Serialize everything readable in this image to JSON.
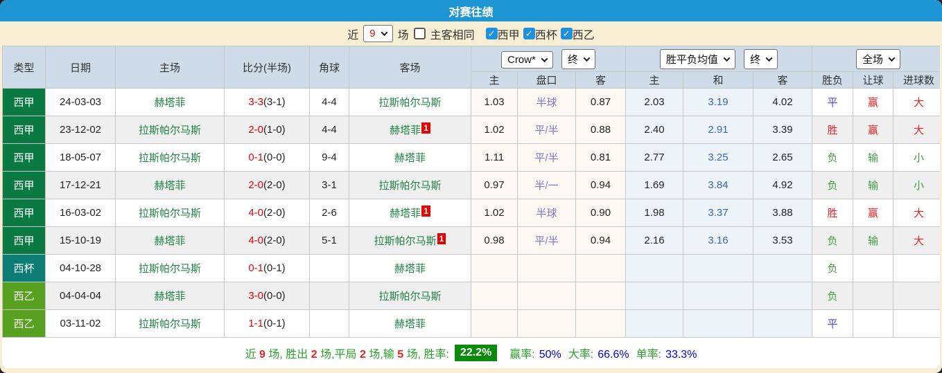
{
  "title": "对赛往绩",
  "colors": {
    "title_bar": "#1f96d4",
    "frame": "#f7eed3",
    "header_bg": "#cedbe9",
    "row_alt": "#efefef",
    "odds_col_bg": "#fdf9f2",
    "avg_col_bg": "#ecf4fa",
    "liga_badge": "#0a7a42",
    "cup_badge": "#0c7d74",
    "segunda_badge": "#57a020",
    "team_green": "#1f8442",
    "score_red": "#e60000",
    "handicap_purple": "#7b76cc",
    "avg_blue": "#3a67ad",
    "result_red": "#e62628",
    "result_green": "#459a45",
    "result_blue": "#4b43e8",
    "checkbox_blue": "#1e90dd",
    "rate_badge_bg": "#0a8a0a",
    "stat_value_blue": "#0000dd",
    "label_green": "#2ba12b"
  },
  "filter": {
    "near_label": "近",
    "count_value": "9",
    "matches_label": "场",
    "check_glyph": "✓",
    "same_venue": {
      "label": "主客相同",
      "checked": false
    },
    "leagues": [
      {
        "label": "西甲",
        "checked": true
      },
      {
        "label": "西杯",
        "checked": true
      },
      {
        "label": "西乙",
        "checked": true
      }
    ]
  },
  "table": {
    "left_headers": [
      "类型",
      "日期",
      "主场",
      "比分(半场)",
      "角球",
      "客场"
    ],
    "groups": [
      {
        "select1": "Crow*",
        "select2": "终",
        "cols": [
          "主",
          "盘口",
          "客"
        ]
      },
      {
        "select1": "胜平负均值",
        "select2": "终",
        "cols": [
          "主",
          "和",
          "客"
        ]
      },
      {
        "select1": "全场",
        "cols": [
          "胜负",
          "让球",
          "进球数"
        ]
      }
    ],
    "rows": [
      {
        "league": "西甲",
        "league_color": "#0a7a42",
        "date": "24-03-03",
        "home": "赫塔菲",
        "score": "3-3",
        "half": "(3-1)",
        "corner": "4-4",
        "away": "拉斯帕尔马斯",
        "away_badge": "",
        "odds": [
          "1.03",
          "半球",
          "0.87"
        ],
        "avg": [
          "2.03",
          "3.19",
          "4.02"
        ],
        "results": [
          {
            "t": "平",
            "c": "blue"
          },
          {
            "t": "赢",
            "c": "red"
          },
          {
            "t": "大",
            "c": "red"
          }
        ]
      },
      {
        "league": "西甲",
        "league_color": "#0a7a42",
        "date": "23-12-02",
        "home": "拉斯帕尔马斯",
        "score": "2-0",
        "half": "(1-0)",
        "corner": "4-4",
        "away": "赫塔菲",
        "away_badge": "1",
        "odds": [
          "1.02",
          "平/半",
          "0.88"
        ],
        "avg": [
          "2.40",
          "2.91",
          "3.39"
        ],
        "results": [
          {
            "t": "胜",
            "c": "red"
          },
          {
            "t": "赢",
            "c": "red"
          },
          {
            "t": "大",
            "c": "red"
          }
        ]
      },
      {
        "league": "西甲",
        "league_color": "#0a7a42",
        "date": "18-05-07",
        "home": "拉斯帕尔马斯",
        "score": "0-1",
        "half": "(0-0)",
        "corner": "9-4",
        "away": "赫塔菲",
        "away_badge": "",
        "odds": [
          "1.11",
          "平/半",
          "0.81"
        ],
        "avg": [
          "2.77",
          "3.25",
          "2.65"
        ],
        "results": [
          {
            "t": "负",
            "c": "green"
          },
          {
            "t": "输",
            "c": "green"
          },
          {
            "t": "小",
            "c": "green"
          }
        ]
      },
      {
        "league": "西甲",
        "league_color": "#0a7a42",
        "date": "17-12-21",
        "home": "赫塔菲",
        "score": "2-0",
        "half": "(2-0)",
        "corner": "3-1",
        "away": "拉斯帕尔马斯",
        "away_badge": "",
        "odds": [
          "0.97",
          "半/一",
          "0.94"
        ],
        "avg": [
          "1.69",
          "3.84",
          "4.92"
        ],
        "results": [
          {
            "t": "负",
            "c": "green"
          },
          {
            "t": "输",
            "c": "green"
          },
          {
            "t": "小",
            "c": "green"
          }
        ]
      },
      {
        "league": "西甲",
        "league_color": "#0a7a42",
        "date": "16-03-02",
        "home": "拉斯帕尔马斯",
        "score": "4-0",
        "half": "(2-0)",
        "corner": "2-6",
        "away": "赫塔菲",
        "away_badge": "1",
        "odds": [
          "1.02",
          "半球",
          "0.90"
        ],
        "avg": [
          "1.98",
          "3.37",
          "3.88"
        ],
        "results": [
          {
            "t": "胜",
            "c": "red"
          },
          {
            "t": "赢",
            "c": "red"
          },
          {
            "t": "大",
            "c": "red"
          }
        ]
      },
      {
        "league": "西甲",
        "league_color": "#0a7a42",
        "date": "15-10-19",
        "home": "赫塔菲",
        "score": "4-0",
        "half": "(2-0)",
        "corner": "5-1",
        "away": "拉斯帕尔马斯",
        "away_badge": "1",
        "odds": [
          "0.98",
          "平/半",
          "0.94"
        ],
        "avg": [
          "2.16",
          "3.16",
          "3.53"
        ],
        "results": [
          {
            "t": "负",
            "c": "green"
          },
          {
            "t": "输",
            "c": "green"
          },
          {
            "t": "大",
            "c": "red"
          }
        ]
      },
      {
        "league": "西杯",
        "league_color": "#0c7d74",
        "date": "04-10-28",
        "home": "拉斯帕尔马斯",
        "score": "0-1",
        "half": "(0-1)",
        "corner": "",
        "away": "赫塔菲",
        "away_badge": "",
        "odds": [
          "",
          "",
          ""
        ],
        "avg": [
          "",
          "",
          ""
        ],
        "results": [
          {
            "t": "负",
            "c": "green"
          },
          {
            "t": "",
            "c": ""
          },
          {
            "t": "",
            "c": ""
          }
        ]
      },
      {
        "league": "西乙",
        "league_color": "#57a020",
        "date": "04-04-04",
        "home": "赫塔菲",
        "score": "3-0",
        "half": "(0-0)",
        "corner": "",
        "away": "拉斯帕尔马斯",
        "away_badge": "",
        "odds": [
          "",
          "",
          ""
        ],
        "avg": [
          "",
          "",
          ""
        ],
        "results": [
          {
            "t": "负",
            "c": "green"
          },
          {
            "t": "",
            "c": ""
          },
          {
            "t": "",
            "c": ""
          }
        ]
      },
      {
        "league": "西乙",
        "league_color": "#57a020",
        "date": "03-11-02",
        "home": "拉斯帕尔马斯",
        "score": "1-1",
        "half": "(0-1)",
        "corner": "",
        "away": "赫塔菲",
        "away_badge": "",
        "odds": [
          "",
          "",
          ""
        ],
        "avg": [
          "",
          "",
          ""
        ],
        "results": [
          {
            "t": "平",
            "c": "blue"
          },
          {
            "t": "",
            "c": ""
          },
          {
            "t": "",
            "c": ""
          }
        ]
      }
    ]
  },
  "summary": {
    "segments": [
      {
        "t": "近 ",
        "c": "green"
      },
      {
        "t": "9",
        "c": "red"
      },
      {
        "t": " 场, 胜出 ",
        "c": "green"
      },
      {
        "t": "2",
        "c": "red"
      },
      {
        "t": " 场,平局 ",
        "c": "green"
      },
      {
        "t": "2",
        "c": "red"
      },
      {
        "t": " 场,输 ",
        "c": "green"
      },
      {
        "t": "5",
        "c": "red"
      },
      {
        "t": " 场, 胜率: ",
        "c": "green"
      }
    ],
    "win_rate": "22.2%",
    "stats": [
      {
        "label": "赢率:",
        "value": "50%"
      },
      {
        "label": "大率:",
        "value": "66.6%"
      },
      {
        "label": "单率:",
        "value": "33.3%"
      }
    ]
  }
}
